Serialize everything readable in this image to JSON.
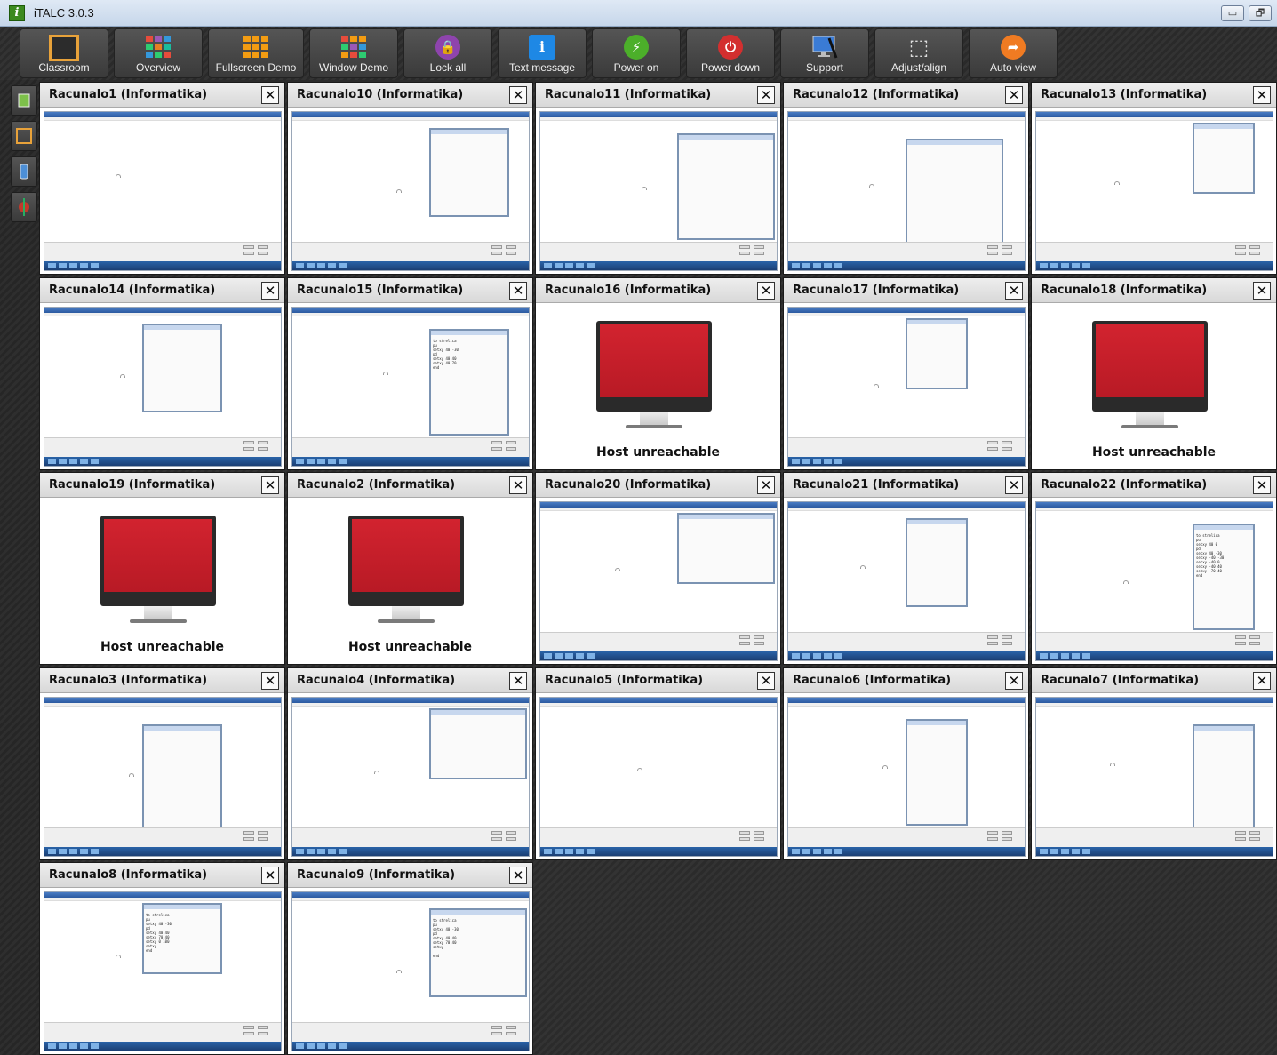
{
  "window": {
    "title": "iTALC 3.0.3",
    "icon_glyph": "i",
    "minimize_glyph": "▭",
    "restore_glyph": "🗗"
  },
  "toolbar": {
    "buttons": [
      {
        "label": "Classroom",
        "icon": "classroom-icon"
      },
      {
        "label": "Overview",
        "icon": "overview-icon"
      },
      {
        "label": "Fullscreen Demo",
        "icon": "fullscreen-demo-icon"
      },
      {
        "label": "Window Demo",
        "icon": "window-demo-icon"
      },
      {
        "label": "Lock all",
        "icon": "lock-icon",
        "glyph": "🔒"
      },
      {
        "label": "Text message",
        "icon": "text-message-icon",
        "glyph": "i"
      },
      {
        "label": "Power on",
        "icon": "power-on-icon",
        "glyph": "⚡"
      },
      {
        "label": "Power down",
        "icon": "power-down-icon",
        "glyph": "⏻"
      },
      {
        "label": "Support",
        "icon": "support-icon"
      },
      {
        "label": "Adjust/align",
        "icon": "adjust-align-icon",
        "glyph": "⬚"
      },
      {
        "label": "Auto view",
        "icon": "auto-view-icon",
        "glyph": "➦"
      }
    ]
  },
  "side_panel": {
    "buttons": [
      "computers-icon",
      "classroom-outline-icon",
      "device-icon",
      "network-icon"
    ]
  },
  "computers": [
    {
      "name": "Racunalo1 (Informatika)",
      "status": "online"
    },
    {
      "name": "Racunalo10 (Informatika)",
      "status": "online"
    },
    {
      "name": "Racunalo11 (Informatika)",
      "status": "online"
    },
    {
      "name": "Racunalo12 (Informatika)",
      "status": "online"
    },
    {
      "name": "Racunalo13 (Informatika)",
      "status": "online"
    },
    {
      "name": "Racunalo14 (Informatika)",
      "status": "online"
    },
    {
      "name": "Racunalo15 (Informatika)",
      "status": "online"
    },
    {
      "name": "Racunalo16 (Informatika)",
      "status": "offline"
    },
    {
      "name": "Racunalo17 (Informatika)",
      "status": "online"
    },
    {
      "name": "Racunalo18 (Informatika)",
      "status": "offline"
    },
    {
      "name": "Racunalo19 (Informatika)",
      "status": "offline"
    },
    {
      "name": "Racunalo2 (Informatika)",
      "status": "offline"
    },
    {
      "name": "Racunalo20 (Informatika)",
      "status": "online"
    },
    {
      "name": "Racunalo21 (Informatika)",
      "status": "online"
    },
    {
      "name": "Racunalo22 (Informatika)",
      "status": "online"
    },
    {
      "name": "Racunalo3 (Informatika)",
      "status": "online"
    },
    {
      "name": "Racunalo4 (Informatika)",
      "status": "online"
    },
    {
      "name": "Racunalo5 (Informatika)",
      "status": "online"
    },
    {
      "name": "Racunalo6 (Informatika)",
      "status": "online"
    },
    {
      "name": "Racunalo7 (Informatika)",
      "status": "online"
    },
    {
      "name": "Racunalo8 (Informatika)",
      "status": "online"
    },
    {
      "name": "Racunalo9 (Informatika)",
      "status": "online"
    }
  ],
  "offline_message": "Host unreachable",
  "close_glyph": "✕",
  "editor_texts": {
    "Racunalo15 (Informatika)": "to strelica\npu\nsetxy 40 -30\npd\nsetxy 40 40\nsetxy 40 70\nend",
    "Racunalo22 (Informatika)": "to strelica\npu\nsetxy 40 0\npd\nsetxy 40 -30\nsetxy -40 -30\nsetxy -40 0\nsetxy -40 40\nsetxy -70 40\nend",
    "Racunalo8 (Informatika)": "to strelica\npu\nsetxy 40 -30\npd\nsetxy 40 40\nsetxy 70 40\nsetxy 0 100\nsetxy\nend",
    "Racunalo9 (Informatika)": "to strelica\npu\nsetxy 40 -30\npd\nsetxy 40 40\nsetxy 70 40\nsetxy\n\nend"
  },
  "colors": {
    "accent_red": "#d2232f",
    "taskbar_blue": "#2a63a8",
    "lock_purple": "#8e44ad",
    "power_on_green": "#4caf2a",
    "power_down_red": "#d32f2f",
    "auto_view_orange": "#f07b22",
    "text_message_blue": "#1e88e5"
  }
}
